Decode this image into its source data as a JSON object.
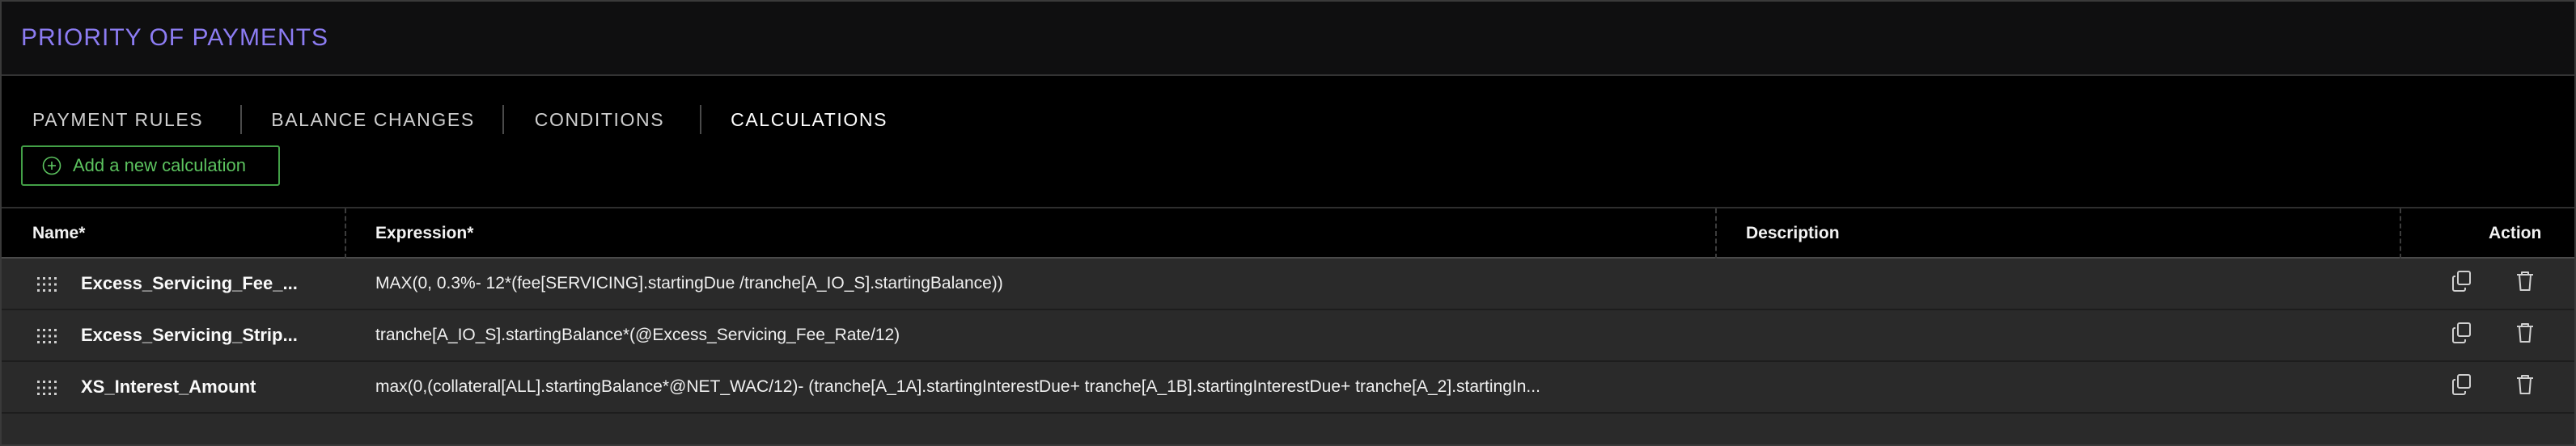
{
  "header": {
    "title": "PRIORITY OF PAYMENTS"
  },
  "tabs": [
    {
      "label": "PAYMENT RULES"
    },
    {
      "label": "BALANCE CHANGES"
    },
    {
      "label": "CONDITIONS"
    },
    {
      "label": "CALCULATIONS"
    }
  ],
  "active_tab": "CALCULATIONS",
  "add_button": {
    "label": "Add a new calculation",
    "icon": "plus-circle-icon"
  },
  "table": {
    "columns": {
      "name": "Name*",
      "expression": "Expression*",
      "description": "Description",
      "action": "Action"
    },
    "rows": [
      {
        "name": "Excess_Servicing_Fee_...",
        "expression": "MAX(0, 0.3%- 12*(fee[SERVICING].startingDue /tranche[A_IO_S].startingBalance))",
        "description": ""
      },
      {
        "name": "Excess_Servicing_Strip...",
        "expression": "tranche[A_IO_S].startingBalance*(@Excess_Servicing_Fee_Rate/12)",
        "description": ""
      },
      {
        "name": "XS_Interest_Amount",
        "expression": "max(0,(collateral[ALL].startingBalance*@NET_WAC/12)- (tranche[A_1A].startingInterestDue+ tranche[A_1B].startingInterestDue+ tranche[A_2].startingIn...",
        "description": ""
      }
    ],
    "row_icons": {
      "drag": "drag-handle-icon",
      "copy": "copy-icon",
      "delete": "trash-icon"
    }
  },
  "colors": {
    "title": "#8c7cf2",
    "button_border": "#43a047",
    "button_text": "#5cc35f",
    "row_bg": "#2a2a2a",
    "header_bg": "#000000"
  }
}
